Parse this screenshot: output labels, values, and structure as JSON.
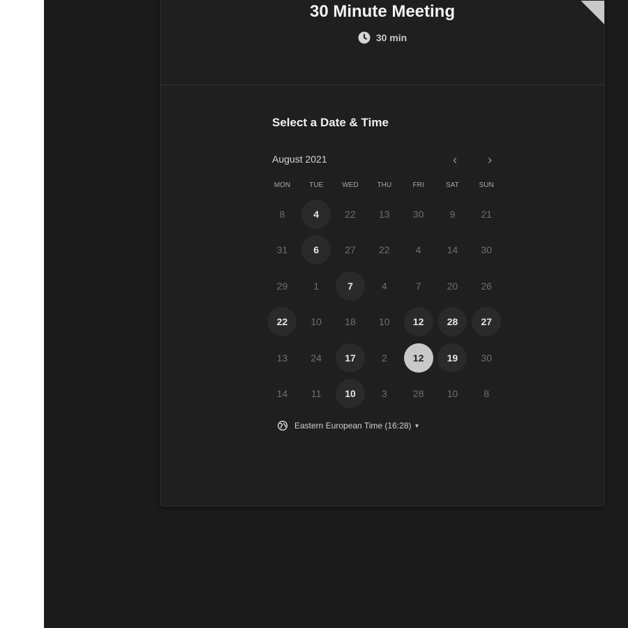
{
  "event": {
    "title": "30 Minute Meeting",
    "duration": "30 min"
  },
  "section_title": "Select a Date & Time",
  "calendar": {
    "month": "August 2021",
    "prev_icon": "‹",
    "next_icon": "›",
    "weekdays": [
      "MON",
      "TUE",
      "WED",
      "THU",
      "FRI",
      "SAT",
      "SUN"
    ],
    "weeks": [
      [
        {
          "label": "8",
          "state": "unavailable"
        },
        {
          "label": "4",
          "state": "available"
        },
        {
          "label": "22",
          "state": "unavailable"
        },
        {
          "label": "13",
          "state": "unavailable"
        },
        {
          "label": "30",
          "state": "unavailable"
        },
        {
          "label": "9",
          "state": "unavailable"
        },
        {
          "label": "21",
          "state": "unavailable"
        }
      ],
      [
        {
          "label": "31",
          "state": "unavailable"
        },
        {
          "label": "6",
          "state": "available"
        },
        {
          "label": "27",
          "state": "unavailable"
        },
        {
          "label": "22",
          "state": "unavailable"
        },
        {
          "label": "4",
          "state": "unavailable"
        },
        {
          "label": "14",
          "state": "unavailable"
        },
        {
          "label": "30",
          "state": "unavailable"
        }
      ],
      [
        {
          "label": "29",
          "state": "unavailable"
        },
        {
          "label": "1",
          "state": "unavailable"
        },
        {
          "label": "7",
          "state": "available"
        },
        {
          "label": "4",
          "state": "unavailable"
        },
        {
          "label": "7",
          "state": "unavailable"
        },
        {
          "label": "20",
          "state": "unavailable"
        },
        {
          "label": "26",
          "state": "unavailable"
        }
      ],
      [
        {
          "label": "22",
          "state": "available"
        },
        {
          "label": "10",
          "state": "unavailable"
        },
        {
          "label": "18",
          "state": "unavailable"
        },
        {
          "label": "10",
          "state": "unavailable"
        },
        {
          "label": "12",
          "state": "available"
        },
        {
          "label": "28",
          "state": "available"
        },
        {
          "label": "27",
          "state": "available"
        }
      ],
      [
        {
          "label": "13",
          "state": "unavailable"
        },
        {
          "label": "24",
          "state": "unavailable"
        },
        {
          "label": "17",
          "state": "available"
        },
        {
          "label": "2",
          "state": "unavailable"
        },
        {
          "label": "12",
          "state": "selected"
        },
        {
          "label": "19",
          "state": "available"
        },
        {
          "label": "30",
          "state": "unavailable"
        }
      ],
      [
        {
          "label": "14",
          "state": "unavailable"
        },
        {
          "label": "11",
          "state": "unavailable"
        },
        {
          "label": "10",
          "state": "available"
        },
        {
          "label": "3",
          "state": "unavailable"
        },
        {
          "label": "28",
          "state": "unavailable"
        },
        {
          "label": "10",
          "state": "unavailable"
        },
        {
          "label": "8",
          "state": "unavailable"
        }
      ]
    ]
  },
  "timezone": {
    "label": "Eastern European Time (16:28)"
  },
  "colors": {
    "background": "#1b1b1b",
    "card": "#1f1f1f",
    "selected_day": "#c9c9c9",
    "available_day": "#2a2a2a"
  }
}
